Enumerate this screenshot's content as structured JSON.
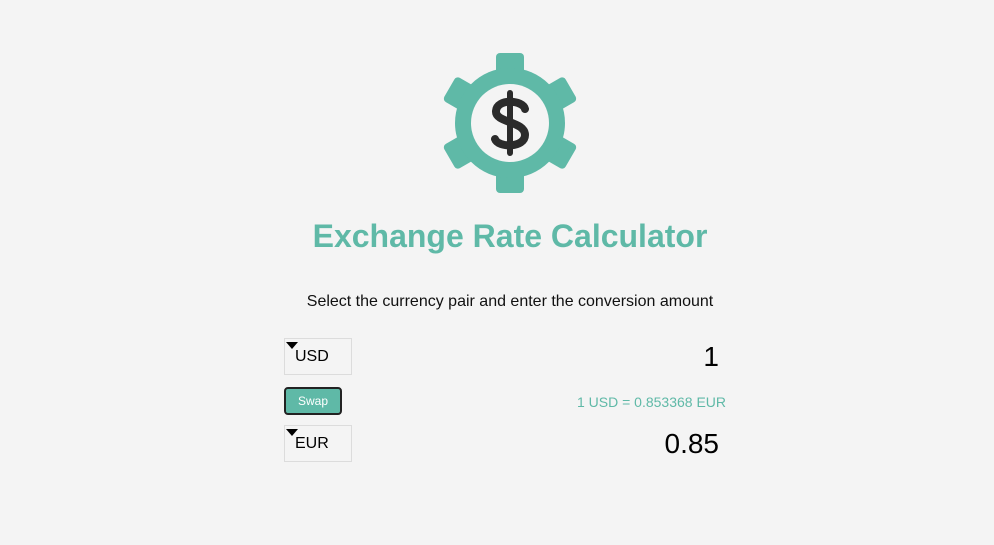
{
  "app": {
    "title": "Exchange Rate Calculator",
    "instructions": "Select the currency pair and enter the conversion amount"
  },
  "colors": {
    "accent": "#5fb9a7",
    "background": "#f4f4f4",
    "icon_dark": "#2b2b2b"
  },
  "icons": {
    "logo": "gear-dollar-icon",
    "select_caret": "caret-down-icon"
  },
  "currency_one": {
    "selected": "USD",
    "amount": "1"
  },
  "currency_two": {
    "selected": "EUR",
    "amount": "0.85"
  },
  "swap": {
    "label": "Swap"
  },
  "rate": {
    "text": "1 USD = 0.853368 EUR"
  }
}
